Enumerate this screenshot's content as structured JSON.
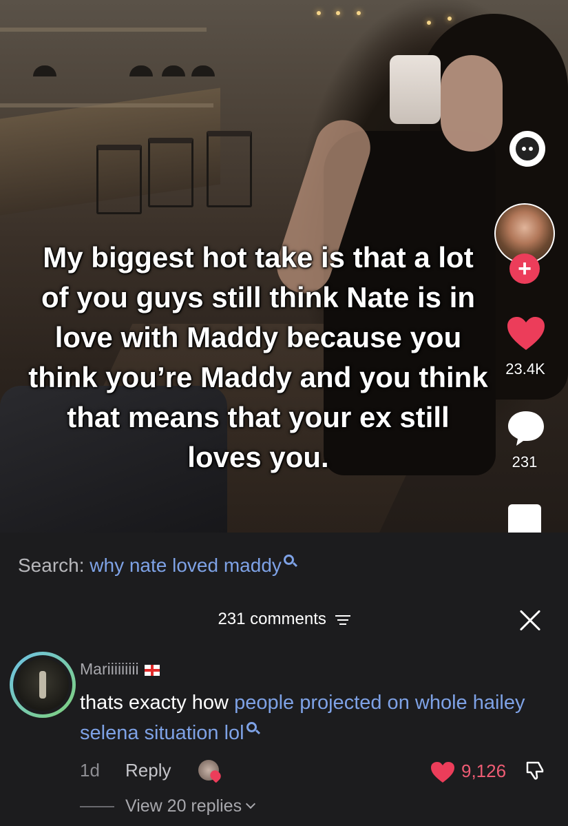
{
  "video": {
    "caption": "My biggest hot take is that a lot of you guys still think Nate is in love with Maddy because you think you’re Maddy and you think that means that your ex still loves you."
  },
  "sidebar": {
    "like_count": "23.4K",
    "comment_count": "231",
    "follow_label": "+"
  },
  "search": {
    "prefix": "Search:",
    "query": "why nate loved maddy"
  },
  "comments_panel": {
    "title": "231 comments",
    "close_label": "✕"
  },
  "comment": {
    "username": "Mariiiiiiiii",
    "text_plain": "thats exacty how ",
    "text_link": "people projected on whole hailey selena situation lol",
    "age": "1d",
    "reply_label": "Reply",
    "likes": "9,126",
    "view_replies": "View 20 replies"
  },
  "colors": {
    "accent_link": "#7ea2e6",
    "like_red": "#ec3d5a",
    "sheet_bg": "#1c1c1e"
  }
}
